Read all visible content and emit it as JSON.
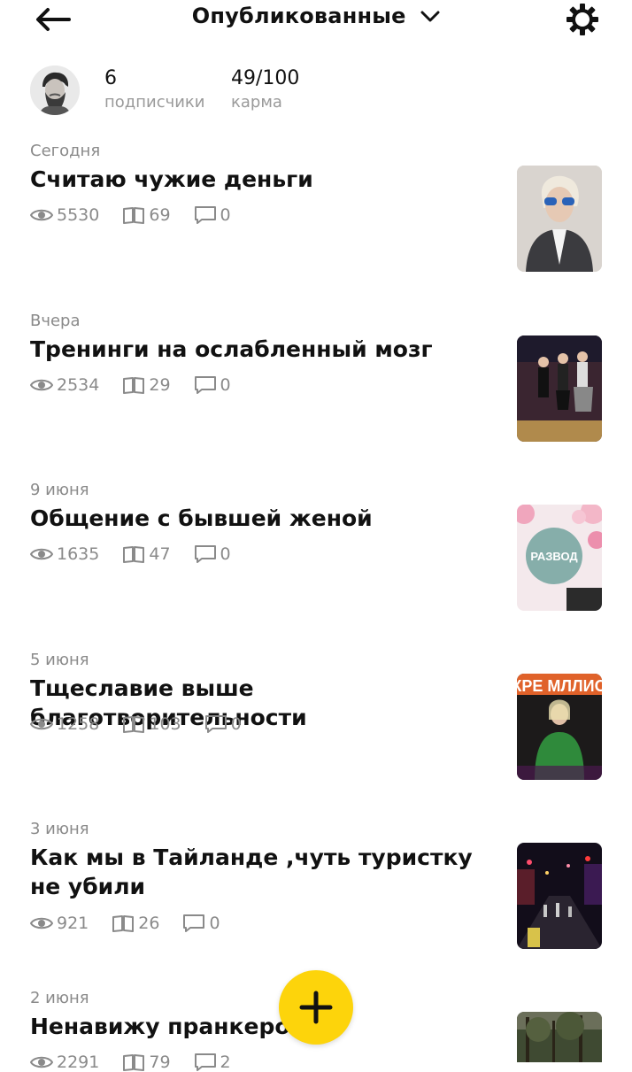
{
  "header": {
    "title": "Опубликованные",
    "back_icon": "arrow-left-icon",
    "settings_icon": "gear-icon"
  },
  "profile": {
    "subscribers_count": "6",
    "subscribers_label": "подписчики",
    "karma_value": "49/100",
    "karma_label": "карма"
  },
  "posts": [
    {
      "date": "Сегодня",
      "title": "Считаю чужие деньги",
      "views": "5530",
      "reads": "69",
      "comments": "0"
    },
    {
      "date": "Вчера",
      "title": "Тренинги на ослабленный мозг",
      "views": "2534",
      "reads": "29",
      "comments": "0"
    },
    {
      "date": "9 июня",
      "title": "Общение с бывшей женой",
      "views": "1635",
      "reads": "47",
      "comments": "0",
      "thumb_text": "РАЗВОД"
    },
    {
      "date": "5 июня",
      "title": "Тщеславие выше благотворительности",
      "views": "1258",
      "reads": "103",
      "comments": "0",
      "thumb_text": "КРЕ МЛЛИО"
    },
    {
      "date": "3 июня",
      "title": "Как мы в Тайланде ,чуть туристку не убили",
      "views": "921",
      "reads": "26",
      "comments": "0"
    },
    {
      "date": "2 июня",
      "title": "Ненавижу пранкеров",
      "views": "2291",
      "reads": "79",
      "comments": "2"
    }
  ],
  "fab": {
    "icon": "plus-icon"
  },
  "colors": {
    "accent": "#fdd40b",
    "muted": "#8a8a8a"
  }
}
